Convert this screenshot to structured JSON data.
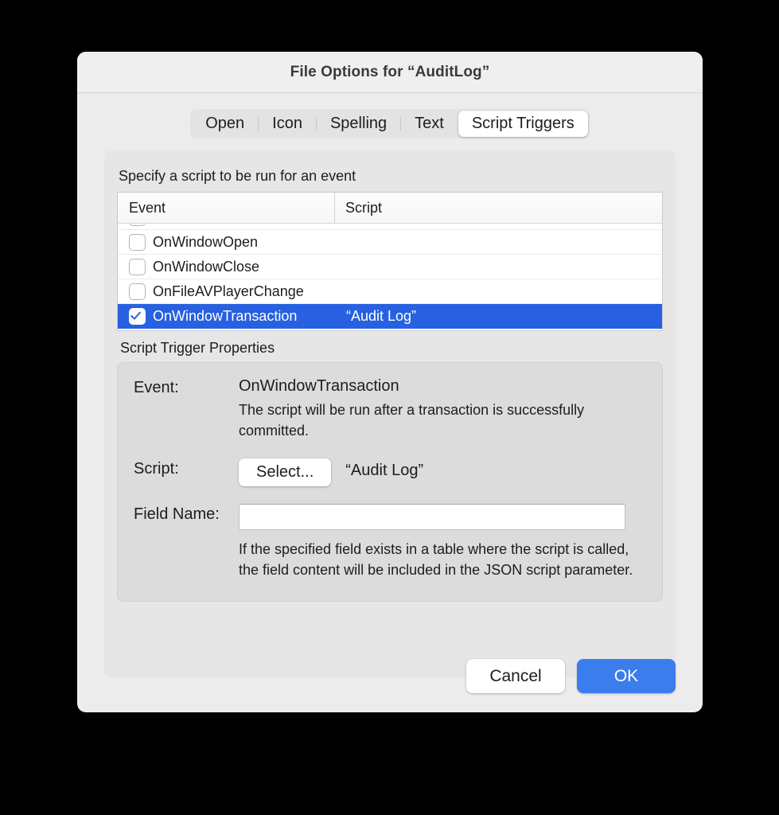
{
  "dialog": {
    "title": "File Options for “AuditLog”"
  },
  "tabs": [
    {
      "label": "Open",
      "selected": false
    },
    {
      "label": "Icon",
      "selected": false
    },
    {
      "label": "Spelling",
      "selected": false
    },
    {
      "label": "Text",
      "selected": false
    },
    {
      "label": "Script Triggers",
      "selected": true
    }
  ],
  "triggers_panel": {
    "instruction": "Specify a script to be run for an event",
    "columns": {
      "event": "Event",
      "script": "Script"
    },
    "rows": [
      {
        "event": "",
        "script": "",
        "checked": false,
        "selected": false,
        "clipped": true
      },
      {
        "event": "OnWindowOpen",
        "script": "",
        "checked": false,
        "selected": false,
        "clipped": false
      },
      {
        "event": "OnWindowClose",
        "script": "",
        "checked": false,
        "selected": false,
        "clipped": false
      },
      {
        "event": "OnFileAVPlayerChange",
        "script": "",
        "checked": false,
        "selected": false,
        "clipped": false
      },
      {
        "event": "OnWindowTransaction",
        "script": "“Audit Log”",
        "checked": true,
        "selected": true,
        "clipped": false
      }
    ]
  },
  "properties": {
    "group_label": "Script Trigger Properties",
    "event_label": "Event:",
    "event_value": "OnWindowTransaction",
    "event_description": "The script will be run after a transaction is successfully committed.",
    "script_label": "Script:",
    "script_button": "Select...",
    "script_value": "“Audit Log”",
    "field_name_label": "Field Name:",
    "field_name_value": "",
    "field_name_description": "If the specified field exists in a table where the script is called, the field content will be included in the JSON script parameter."
  },
  "footer": {
    "cancel": "Cancel",
    "ok": "OK"
  },
  "colors": {
    "selection_blue": "#2760e0",
    "ok_blue": "#3b7ded",
    "dialog_bg": "#ececec",
    "panel_bg": "#e6e6e6",
    "props_bg": "#dcdcdc"
  }
}
